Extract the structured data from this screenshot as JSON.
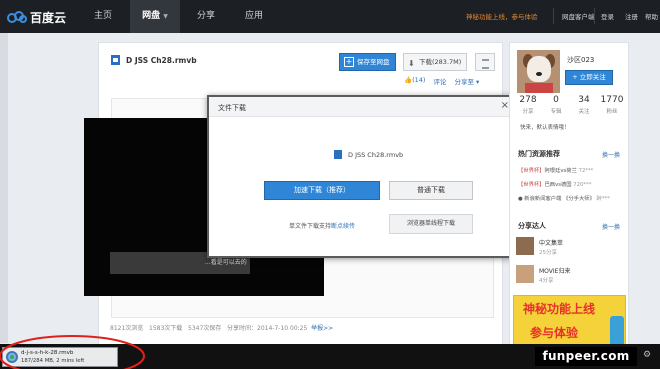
{
  "nav": {
    "logo_text": "百度云",
    "items": [
      {
        "label": "主页"
      },
      {
        "label": "网盘"
      },
      {
        "label": "分享"
      },
      {
        "label": "应用"
      }
    ],
    "promo": "神秘功能上线，参与体验",
    "links": [
      "网盘客户端",
      "登录",
      "注册",
      "帮助"
    ]
  },
  "file": {
    "name": "D JSS Ch28.rmvb",
    "save_label": "保存至网盘",
    "download_label": "下载(283.7M)",
    "like_count": "(14)",
    "comment_label": "评论",
    "share_label": "分享至"
  },
  "video": {
    "subtitle": "...看是可以去的"
  },
  "stats": {
    "views": "8121次浏览",
    "downloads": "1583次下载",
    "saves": "5347次保存",
    "share_time": "分享时间：2014-7-10 00:25",
    "report": "举报>>"
  },
  "modal": {
    "title": "文件下载",
    "close": "×",
    "file_name": "D JSS Ch28.rmvb",
    "fast_label": "加速下载（推荐）",
    "normal_label": "普通下载",
    "resume_prefix": "单文件下载支持",
    "resume_link": "断点续传",
    "browser_label": "浏览器单线程下载"
  },
  "sidebar": {
    "user_name": "沙区023",
    "follow_label": "+ 立即关注",
    "stats": [
      {
        "num": "278",
        "label": "分享"
      },
      {
        "num": "0",
        "label": "专辑"
      },
      {
        "num": "34",
        "label": "关注"
      },
      {
        "num": "1770",
        "label": "粉丝"
      }
    ],
    "motto": "快来，默认表情哦！",
    "hot_title": "热门资源推荐",
    "hot_more": "换一换",
    "hot_items": [
      {
        "tag": "【世界杯】",
        "text": "阿根廷vs荷兰",
        "count": "72***"
      },
      {
        "tag": "【世界杯】",
        "text": "巴西vs德国",
        "count": "720***"
      },
      {
        "tag": "",
        "text": "● 新浪新闻客户端 《分手大师》",
        "count": "醉***"
      }
    ],
    "sharers_title": "分享达人",
    "sharers_more": "换一换",
    "sharers": [
      {
        "name": "中文集萃",
        "count": "25分享"
      },
      {
        "name": "MOVIE归来",
        "count": "4分享"
      }
    ],
    "ad_line1": "神秘功能上线",
    "ad_line2": "参与体验"
  },
  "download_bar": {
    "file": "d-j-s-s-h-k-28.rmvb",
    "progress": "187/284 MB, 2 mins left"
  },
  "watermark": "funpeer.com",
  "colors": {
    "accent_blue": "#2f86d6",
    "topbar": "#1c1f24",
    "promo_orange": "#e8872b",
    "annotation_red": "#e0211b"
  }
}
